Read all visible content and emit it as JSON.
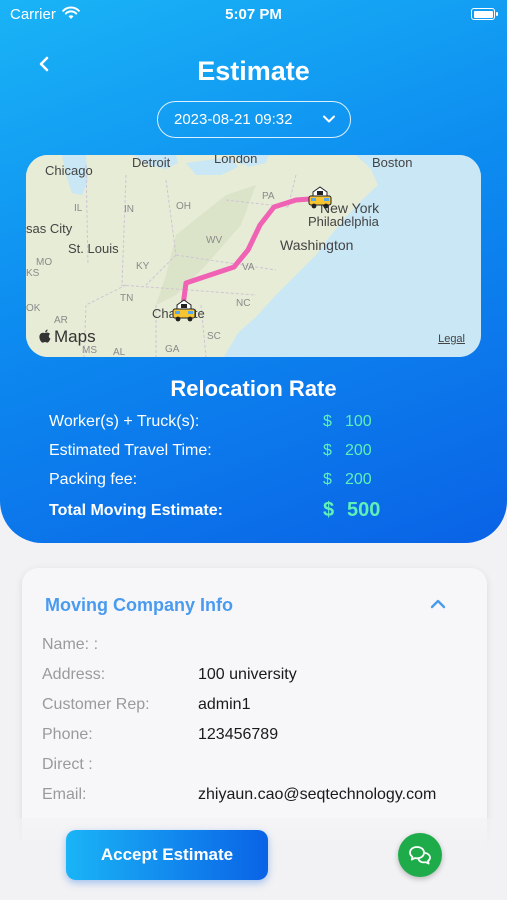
{
  "status_bar": {
    "carrier": "Carrier",
    "time": "5:07 PM"
  },
  "header": {
    "title": "Estimate",
    "date_value": "2023-08-21 09:32"
  },
  "map": {
    "labels": {
      "chicago": "Chicago",
      "detroit": "Detroit",
      "london": "London",
      "boston": "Boston",
      "new_york": "New York",
      "philadelphia": "Philadelphia",
      "washington": "Washington",
      "st_louis": "St. Louis",
      "kansas_city": "sas City",
      "charlotte": "Charlotte",
      "il": "IL",
      "in": "IN",
      "oh": "OH",
      "pa": "PA",
      "mo": "MO",
      "ks": "KS",
      "ky": "KY",
      "wv": "WV",
      "va": "VA",
      "tn": "TN",
      "nc": "NC",
      "sc": "SC",
      "ga": "GA",
      "al": "AL",
      "ms": "MS",
      "ok": "OK",
      "ar": "AR"
    },
    "attribution": "Maps",
    "legal": "Legal",
    "colors": {
      "route": "#f062b4",
      "water": "#c9e7f5",
      "land": "#e8ecd8"
    }
  },
  "relocation": {
    "title": "Relocation Rate",
    "currency": "$",
    "rows": [
      {
        "label": "Worker(s) + Truck(s):",
        "value": "100"
      },
      {
        "label": "Estimated Travel Time:",
        "value": "200"
      },
      {
        "label": "Packing fee:",
        "value": "200"
      }
    ],
    "total": {
      "label": "Total Moving Estimate:",
      "value": "500"
    },
    "colors": {
      "value": "#5ff0b8"
    }
  },
  "company_info": {
    "title": "Moving Company Info",
    "rows": [
      {
        "label": "Name: :",
        "value": ""
      },
      {
        "label": "Address:",
        "value": "100 university"
      },
      {
        "label": "Customer Rep:",
        "value": "admin1"
      },
      {
        "label": "Phone:",
        "value": "123456789"
      },
      {
        "label": "Direct :",
        "value": ""
      },
      {
        "label": "Email:",
        "value": "zhiyaun.cao@seqtechnology.com"
      }
    ]
  },
  "actions": {
    "accept_label": "Accept Estimate"
  },
  "theme": {
    "accent_start": "#1ab4f6",
    "accent_end": "#0a63e6",
    "chat": "#1eac4b",
    "info_title": "#4a9bf0"
  }
}
